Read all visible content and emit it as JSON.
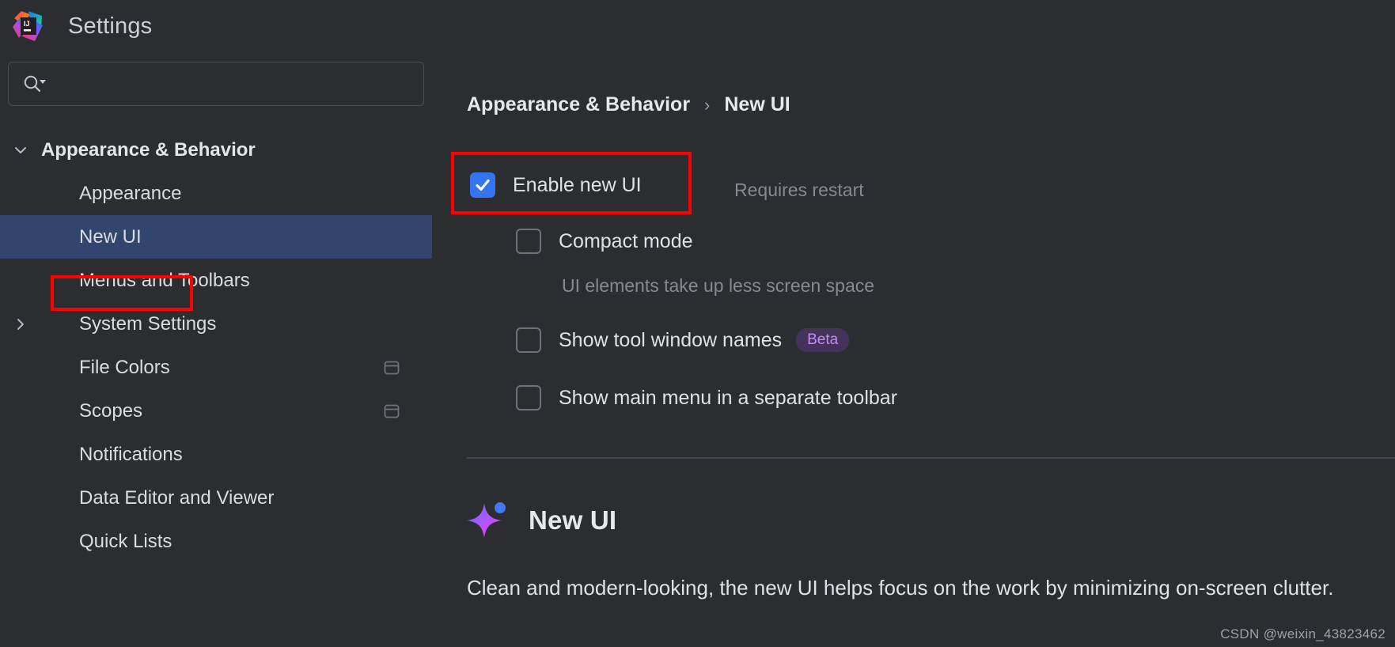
{
  "window": {
    "title": "Settings",
    "logo_text": "IJ"
  },
  "sidebar": {
    "search": {
      "placeholder": "",
      "value": "",
      "icon": "search-icon",
      "dropdown_icon": "triangle-down-icon"
    },
    "items": [
      {
        "label": "Appearance & Behavior",
        "level": 0,
        "twisty": "chevron-down-icon",
        "selected": false,
        "aux_icon": ""
      },
      {
        "label": "Appearance",
        "level": 1,
        "twisty": "",
        "selected": false,
        "aux_icon": ""
      },
      {
        "label": "New UI",
        "level": 1,
        "twisty": "",
        "selected": true,
        "aux_icon": ""
      },
      {
        "label": "Menus and Toolbars",
        "level": 1,
        "twisty": "",
        "selected": false,
        "aux_icon": ""
      },
      {
        "label": "System Settings",
        "level": 1,
        "twisty": "chevron-right-icon",
        "selected": false,
        "aux_icon": ""
      },
      {
        "label": "File Colors",
        "level": 1,
        "twisty": "",
        "selected": false,
        "aux_icon": "project-scope-icon"
      },
      {
        "label": "Scopes",
        "level": 1,
        "twisty": "",
        "selected": false,
        "aux_icon": "project-scope-icon"
      },
      {
        "label": "Notifications",
        "level": 1,
        "twisty": "",
        "selected": false,
        "aux_icon": ""
      },
      {
        "label": "Data Editor and Viewer",
        "level": 1,
        "twisty": "",
        "selected": false,
        "aux_icon": ""
      },
      {
        "label": "Quick Lists",
        "level": 1,
        "twisty": "",
        "selected": false,
        "aux_icon": ""
      }
    ]
  },
  "breadcrumb": {
    "parent": "Appearance & Behavior",
    "separator": "›",
    "current": "New UI"
  },
  "options": {
    "enable_new_ui": {
      "label": "Enable new UI",
      "checked": true,
      "note": "Requires restart"
    },
    "compact_mode": {
      "label": "Compact mode",
      "checked": false,
      "hint": "UI elements take up less screen space"
    },
    "show_tool_window_names": {
      "label": "Show tool window names",
      "checked": false,
      "badge": "Beta"
    },
    "show_main_menu": {
      "label": "Show main menu in a separate toolbar",
      "checked": false
    }
  },
  "section": {
    "icon": "sparkle-icon",
    "title": "New UI",
    "description": "Clean and modern-looking, the new UI helps focus on the work by minimizing on-screen clutter."
  },
  "watermark": "CSDN @weixin_43823462",
  "colors": {
    "background": "#2B2D30",
    "selection": "#32456E",
    "accent_checkbox": "#3574F0",
    "annotation": "#FF0000",
    "badge_bg": "#433358",
    "badge_fg": "#C58AF9",
    "muted_text": "#868A91"
  }
}
